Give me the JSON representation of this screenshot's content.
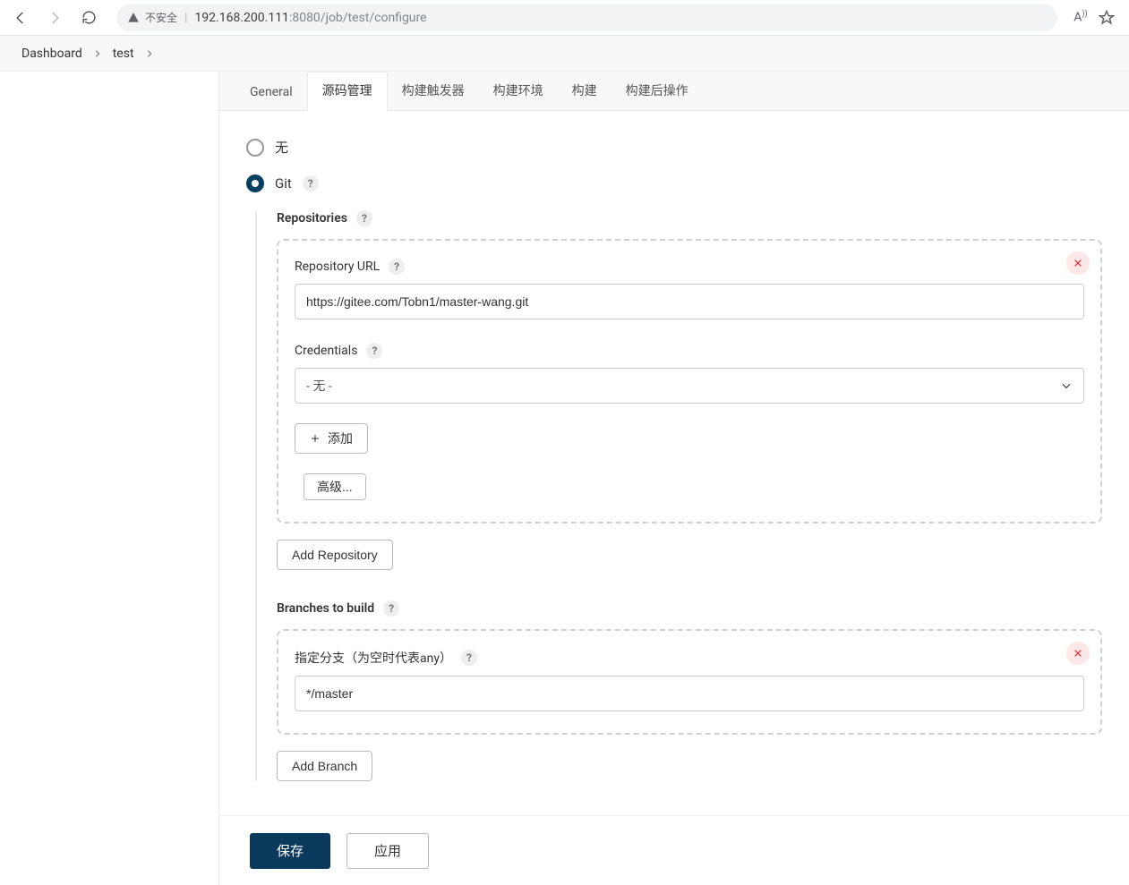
{
  "browser": {
    "insecure_label": "不安全",
    "url_host": "192.168.200.111",
    "url_port": ":8080",
    "url_path": "/job/test/configure"
  },
  "breadcrumb": {
    "items": [
      "Dashboard",
      "test"
    ]
  },
  "tabs": {
    "items": [
      "General",
      "源码管理",
      "构建触发器",
      "构建环境",
      "构建",
      "构建后操作"
    ],
    "active_index": 1
  },
  "scm": {
    "none_label": "无",
    "git_label": "Git",
    "repositories_label": "Repositories",
    "repo_url_label": "Repository URL",
    "repo_url_value": "https://gitee.com/Tobn1/master-wang.git",
    "credentials_label": "Credentials",
    "credentials_selected": "- 无 -",
    "add_cred_label": "添加",
    "advanced_label": "高级...",
    "add_repository_label": "Add Repository",
    "branches_label": "Branches to build",
    "branch_spec_label": "指定分支（为空时代表any）",
    "branch_spec_value": "*/master",
    "add_branch_label": "Add Branch"
  },
  "footer": {
    "save_label": "保存",
    "apply_label": "应用"
  }
}
